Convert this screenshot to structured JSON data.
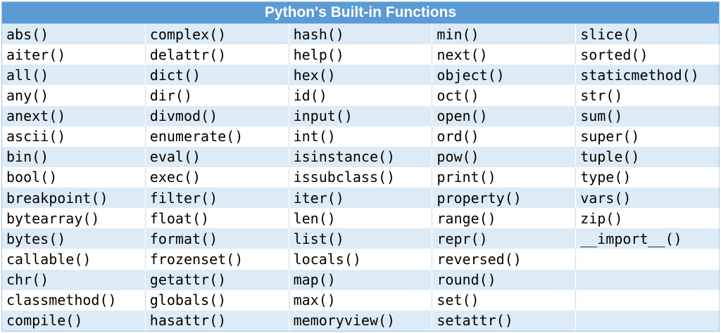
{
  "title": "Python's Built-in Functions",
  "columns": [
    [
      "abs()",
      "aiter()",
      "all()",
      "any()",
      "anext()",
      "ascii()",
      "bin()",
      "bool()",
      "breakpoint()",
      "bytearray()",
      "bytes()",
      "callable()",
      "chr()",
      "classmethod()",
      "compile()"
    ],
    [
      "complex()",
      "delattr()",
      "dict()",
      "dir()",
      "divmod()",
      "enumerate()",
      "eval()",
      "exec()",
      "filter()",
      "float()",
      "format()",
      "frozenset()",
      "getattr()",
      "globals()",
      "hasattr()"
    ],
    [
      "hash()",
      "help()",
      "hex()",
      "id()",
      "input()",
      "int()",
      "isinstance()",
      "issubclass()",
      "iter()",
      "len()",
      "list()",
      "locals()",
      "map()",
      "max()",
      "memoryview()"
    ],
    [
      "min()",
      "next()",
      "object()",
      "oct()",
      "open()",
      "ord()",
      "pow()",
      "print()",
      "property()",
      "range()",
      "repr()",
      "reversed()",
      "round()",
      "set()",
      "setattr()"
    ],
    [
      "slice()",
      "sorted()",
      "staticmethod()",
      "str()",
      "sum()",
      "super()",
      "tuple()",
      "type()",
      "vars()",
      "zip()",
      "__import__()",
      "",
      "",
      "",
      ""
    ]
  ]
}
